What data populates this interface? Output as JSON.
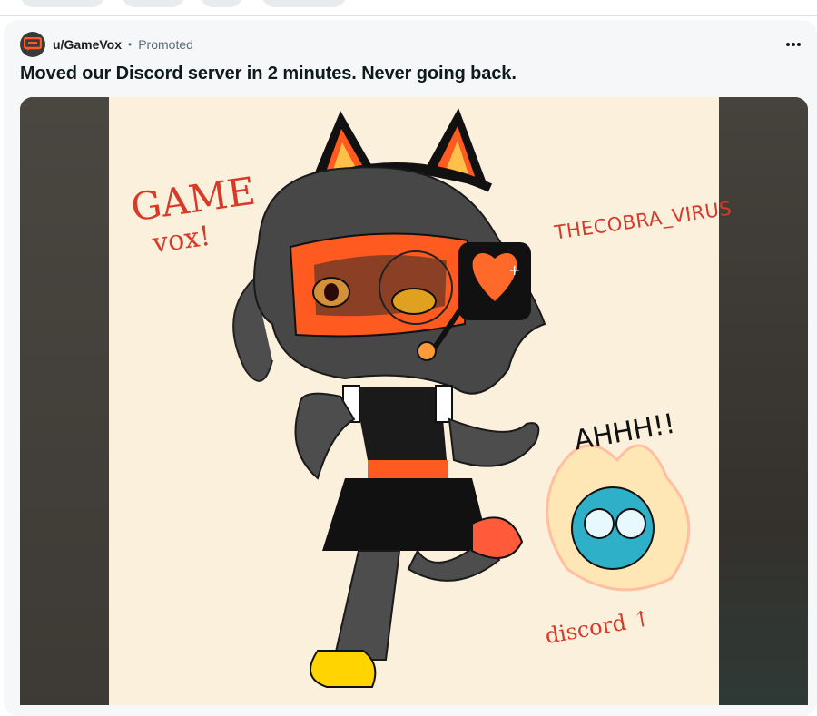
{
  "post": {
    "username": "u/GameVox",
    "separator": "•",
    "promoted_label": "Promoted",
    "title": "Moved our Discord server in 2 minutes. Never going back."
  },
  "artwork": {
    "text_game": "GAME",
    "text_vox": "vox!",
    "text_artist": "THECOBRA_VIRUS",
    "text_ahhh": "AHHH!!",
    "text_discord": "discord ↑"
  },
  "colors": {
    "accent_orange": "#ff5a1f",
    "background": "#ffffff",
    "card": "#f5f7f8",
    "art_bg": "#fbf0db",
    "handwriting_red": "#d83a2a"
  },
  "icons": {
    "avatar": "gamevox-logo-icon",
    "more": "more-options-icon"
  }
}
